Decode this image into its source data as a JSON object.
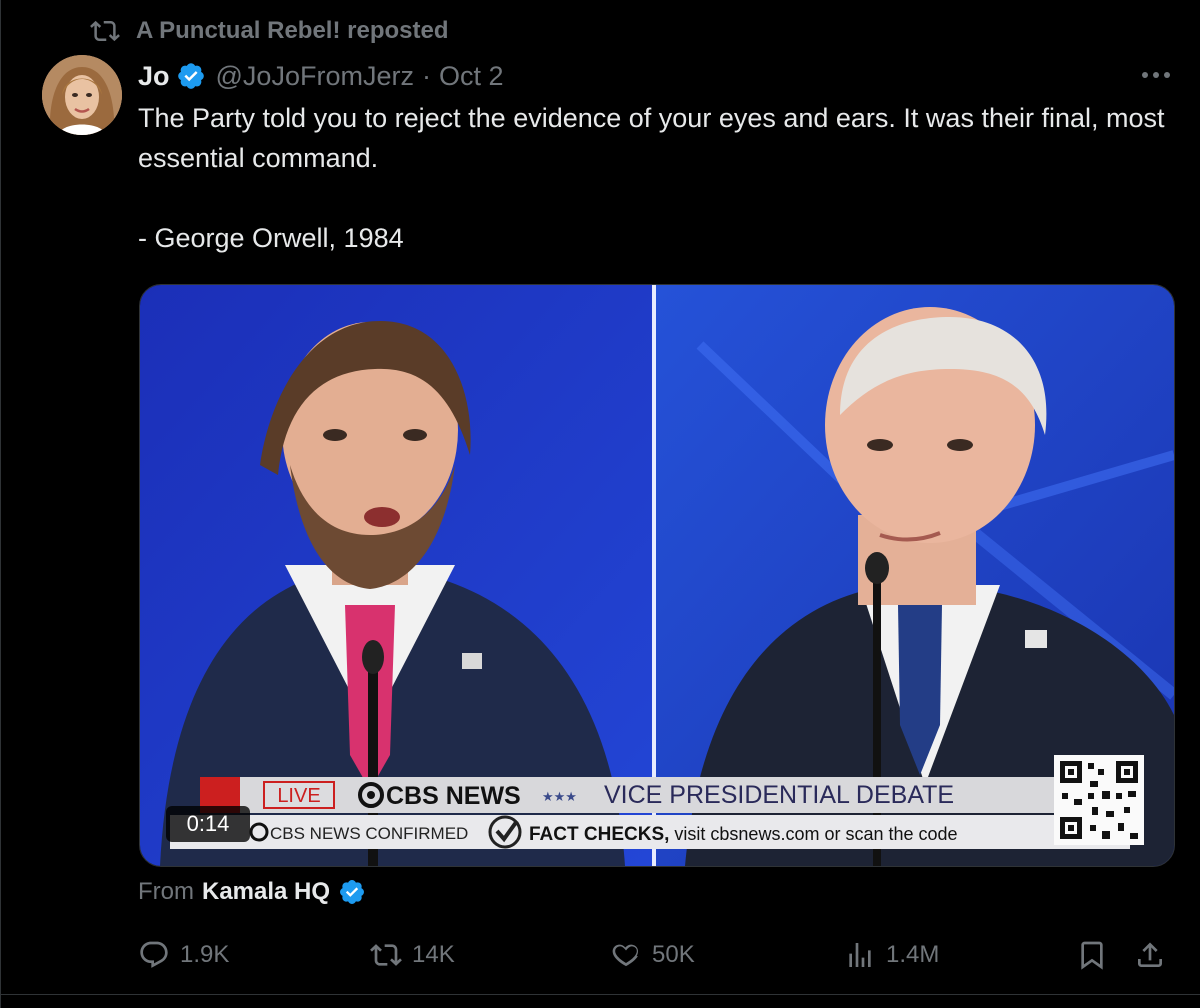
{
  "repost": {
    "label": "A Punctual Rebel! reposted"
  },
  "author": {
    "name": "Jo",
    "handle": "@JoJoFromJerz",
    "separator": "·",
    "date": "Oct 2"
  },
  "tweet": {
    "text": "The Party told you to reject the evidence of your eyes and ears. It was their final, most essential command.\n\n- George Orwell, 1984"
  },
  "video": {
    "timestamp": "0:14",
    "chyron": {
      "live": "LIVE",
      "network": "CBS NEWS",
      "stars": "★★★",
      "title": "VICE PRESIDENTIAL DEBATE",
      "confirmed_prefix": "CBS NEWS CONFIRMED",
      "fact_checks": "FACT CHECKS,",
      "visit": " visit cbsnews.com or scan the code"
    }
  },
  "source": {
    "label": "From",
    "name": "Kamala HQ"
  },
  "actions": {
    "replies": "1.9K",
    "reposts": "14K",
    "likes": "50K",
    "views": "1.4M"
  },
  "colors": {
    "verified": "#1d9bf0",
    "muted": "#71767b",
    "text": "#e7e9ea"
  }
}
